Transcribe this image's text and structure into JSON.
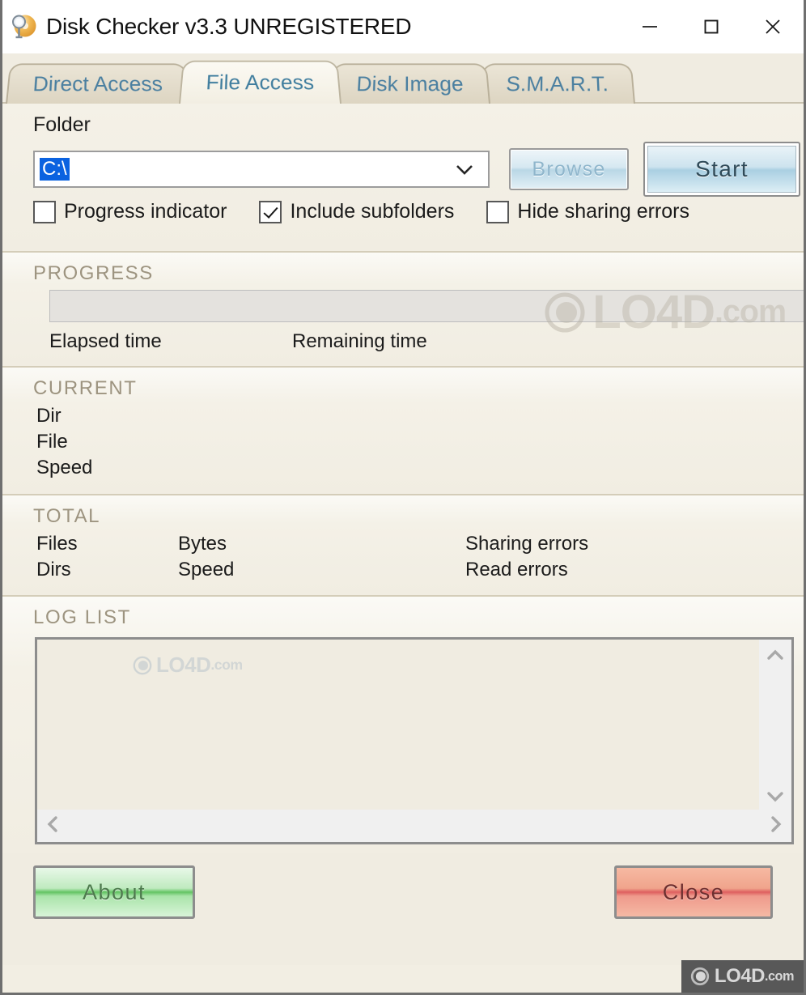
{
  "window": {
    "title": "Disk Checker v3.3 UNREGISTERED",
    "icon": "disk-magnifier-icon",
    "controls": {
      "minimize": "minimize-icon",
      "maximize": "maximize-icon",
      "close": "close-icon"
    }
  },
  "tabs": [
    {
      "label": "Direct Access",
      "selected": false
    },
    {
      "label": "File Access",
      "selected": true
    },
    {
      "label": "Disk Image",
      "selected": false
    },
    {
      "label": "S.M.A.R.T.",
      "selected": false
    }
  ],
  "folder": {
    "label": "Folder",
    "value": "C:\\",
    "placeholder": "",
    "dropdown_icon": "chevron-down-icon",
    "browse_label": "Browse",
    "start_label": "Start"
  },
  "options": [
    {
      "label": "Progress indicator",
      "checked": false
    },
    {
      "label": "Include subfolders",
      "checked": true
    },
    {
      "label": "Hide sharing errors",
      "checked": false
    }
  ],
  "progress": {
    "heading": "PROGRESS",
    "value": 0,
    "elapsed_label": "Elapsed time",
    "elapsed_value": "",
    "remaining_label": "Remaining time",
    "remaining_value": ""
  },
  "current": {
    "heading": "CURRENT",
    "fields": [
      {
        "label": "Dir",
        "value": ""
      },
      {
        "label": "File",
        "value": ""
      },
      {
        "label": "Speed",
        "value": ""
      }
    ]
  },
  "total": {
    "heading": "TOTAL",
    "rows": [
      [
        {
          "label": "Files",
          "value": ""
        },
        {
          "label": "Bytes",
          "value": ""
        },
        {
          "label": "Sharing errors",
          "value": ""
        }
      ],
      [
        {
          "label": "Dirs",
          "value": ""
        },
        {
          "label": "Speed",
          "value": ""
        },
        {
          "label": "Read errors",
          "value": ""
        }
      ]
    ]
  },
  "log": {
    "heading": "LOG LIST",
    "entries": [],
    "scroll_up_icon": "chevron-up-icon",
    "scroll_down_icon": "chevron-down-icon",
    "scroll_left_icon": "chevron-left-icon",
    "scroll_right_icon": "chevron-right-icon"
  },
  "footer": {
    "about_label": "About",
    "close_label": "Close"
  },
  "watermark": {
    "text": "LO4D",
    "suffix": ".com"
  },
  "colors": {
    "window_bg": "#f0ece1",
    "panel_bg": "#f2eee3",
    "tab_text": "#4a7fa0",
    "heading_text": "#9d9480",
    "selection_blue": "#0a62e0",
    "about_green": "#63c463",
    "close_red": "#de5f5f"
  }
}
